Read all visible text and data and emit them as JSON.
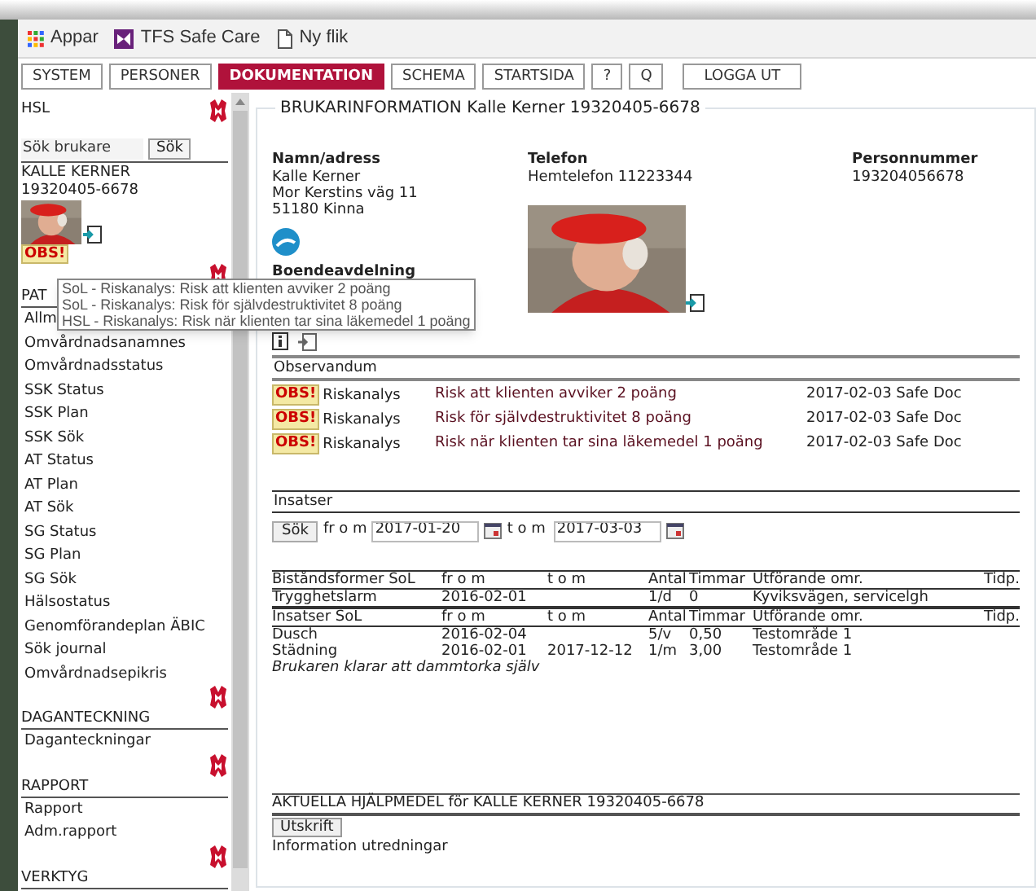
{
  "bookmarks": [
    {
      "label": "Appar",
      "kind": "apps"
    },
    {
      "label": "TFS Safe Care",
      "kind": "app"
    },
    {
      "label": "Ny flik",
      "kind": "page"
    }
  ],
  "nav_buttons": [
    {
      "label": "SYSTEM",
      "selected": false
    },
    {
      "label": "PERSONER",
      "selected": false
    },
    {
      "label": "DOKUMENTATION",
      "selected": true
    },
    {
      "label": "SCHEMA",
      "selected": false
    },
    {
      "label": "STARTSIDA",
      "selected": false
    },
    {
      "label": "?",
      "selected": false
    },
    {
      "label": "Q",
      "selected": false
    },
    {
      "label": "LOGGA UT",
      "selected": false
    }
  ],
  "sidebar": {
    "title": "HSL",
    "search": {
      "placeholder": "Sök brukare",
      "button": "Sök"
    },
    "client_name": "KALLE KERNER",
    "client_id": "19320405-6678",
    "badge": "OBS!",
    "sections": [
      {
        "title": "PAT",
        "items": [
          "Allm",
          "Omvårdnadsanamnes",
          "Omvårdnadsstatus",
          "SSK Status",
          "SSK Plan",
          "SSK Sök",
          "AT Status",
          "AT Plan",
          "AT Sök",
          "SG Status",
          "SG Plan",
          "SG Sök",
          "Hälsostatus",
          "Genomförandeplan ÄBIC",
          "Sök journal",
          "Omvårdnadsepikris"
        ]
      },
      {
        "title": "DAGANTECKNING",
        "items": [
          "Daganteckningar"
        ]
      },
      {
        "title": "RAPPORT",
        "items": [
          "Rapport",
          "Adm.rapport"
        ]
      },
      {
        "title": "VERKTYG"
      }
    ]
  },
  "main": {
    "title": "BRUKARINFORMATION Kalle Kerner 19320405-6678",
    "address": {
      "label": "Namn/adress",
      "lines": [
        "Kalle Kerner",
        "Mor Kerstins väg 11",
        "51180 Kinna"
      ]
    },
    "phone": {
      "label": "Telefon",
      "text": "Hemtelefon 11223344"
    },
    "personal_number": {
      "label": "Personnummer",
      "value": "193204056678"
    },
    "housing": {
      "label": "Boendeavdelning"
    },
    "observandum": {
      "title": "Observandum",
      "rows": [
        {
          "badge": "OBS!",
          "type": "Riskanalys",
          "text": "Risk att klienten avviker 2 poäng",
          "meta": "2017-02-03 Safe Doc"
        },
        {
          "badge": "OBS!",
          "type": "Riskanalys",
          "text": "Risk för självdestruktivitet 8 poäng",
          "meta": "2017-02-03 Safe Doc"
        },
        {
          "badge": "OBS!",
          "type": "Riskanalys",
          "text": "Risk när klienten tar sina läkemedel 1 poäng",
          "meta": "2017-02-03 Safe Doc"
        }
      ]
    },
    "insatser": {
      "title": "Insatser",
      "button": "Sök",
      "from_label": "fr o m",
      "from": "2017-01-20",
      "to_label": "t o m",
      "to": "2017-03-03"
    },
    "tables": [
      {
        "columns": [
          "Biståndsformer SoL",
          "fr o m",
          "t o m",
          "Antal",
          "Timmar",
          "Utförande omr.",
          "Tidp."
        ],
        "rows": [
          [
            "Trygghetslarm",
            "2016-02-01",
            "",
            "1/d",
            "0",
            "Kyviksvägen, servicelgh",
            ""
          ]
        ]
      },
      {
        "columns": [
          "Insatser SoL",
          "fr o m",
          "t o m",
          "Antal",
          "Timmar",
          "Utförande omr.",
          "Tidp."
        ],
        "rows": [
          [
            "Dusch",
            "2016-02-04",
            "",
            "5/v",
            "0,50",
            "Testområde 1",
            ""
          ],
          [
            "Städning",
            "2016-02-01",
            "2017-12-12",
            "1/m",
            "3,00",
            "Testområde 1",
            ""
          ]
        ],
        "note": "Brukaren klarar att dammtorka själv"
      }
    ],
    "aids": {
      "title": "AKTUELLA HJÄLPMEDEL för KALLE KERNER 19320405-6678",
      "button": "Utskrift",
      "info": "Information utredningar"
    }
  },
  "tooltip": {
    "lines": [
      "SoL - Riskanalys: Risk att klienten avviker 2 poäng",
      "SoL - Riskanalys: Risk för självdestruktivitet 8 poäng",
      "HSL - Riskanalys: Risk när klienten tar sina läkemedel 1 poäng"
    ]
  }
}
